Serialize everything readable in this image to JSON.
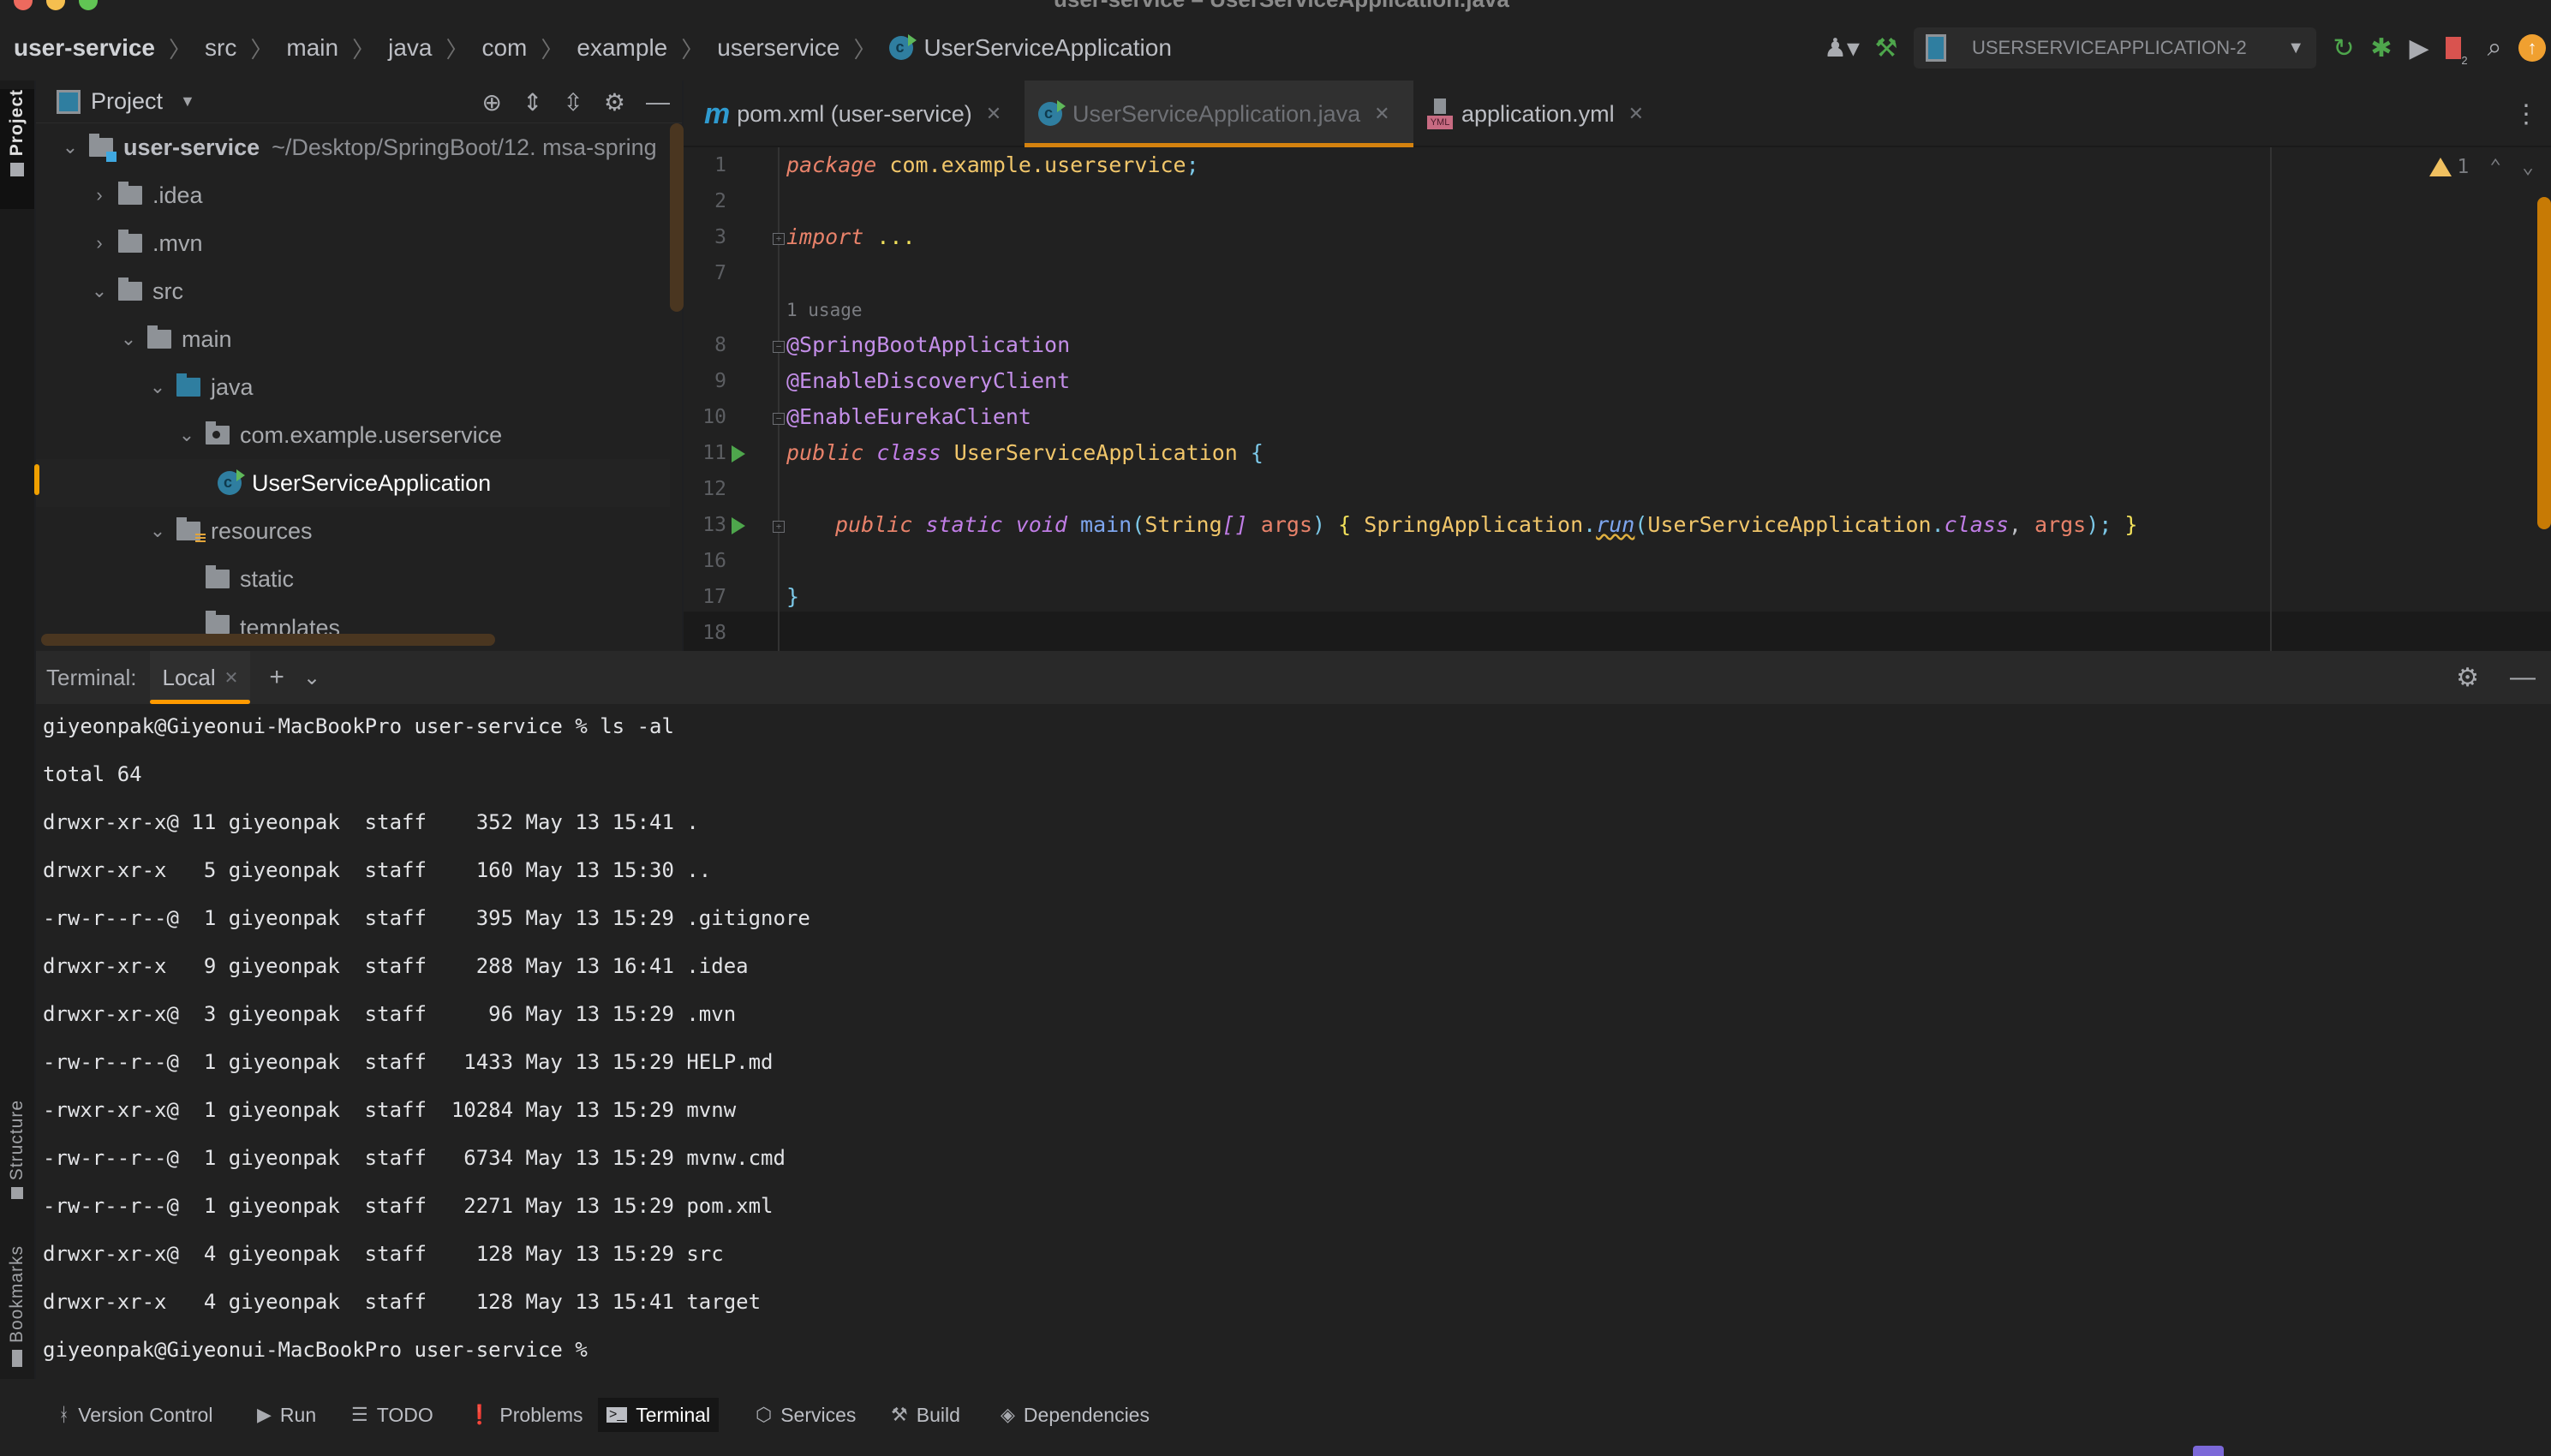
{
  "window": {
    "title": "user-service – UserServiceApplication.java",
    "traffic_colors": [
      "#ed6a5e",
      "#f5bf4f",
      "#61c554"
    ]
  },
  "navbar": {
    "breadcrumb": [
      "user-service",
      "src",
      "main",
      "java",
      "com",
      "example",
      "userservice",
      "UserServiceApplication"
    ],
    "run_config": "USERSERVICEAPPLICATION-2",
    "icons": [
      "vcs-user-icon",
      "build-hammer-icon",
      "run-icon",
      "debug-icon",
      "coverage-icon",
      "stop-icon",
      "search-icon",
      "update-icon"
    ],
    "stop_badge": "2"
  },
  "left_strip": {
    "top": "Project",
    "structure": "Structure",
    "bookmarks": "Bookmarks"
  },
  "project": {
    "title": "Project",
    "tree": [
      {
        "label": "user-service",
        "suffix": "~/Desktop/SpringBoot/12. msa-spring",
        "depth": 0,
        "expanded": true,
        "type": "module"
      },
      {
        "label": ".idea",
        "depth": 1,
        "expanded": false,
        "type": "folder"
      },
      {
        "label": ".mvn",
        "depth": 1,
        "expanded": false,
        "type": "folder"
      },
      {
        "label": "src",
        "depth": 1,
        "expanded": true,
        "type": "folder"
      },
      {
        "label": "main",
        "depth": 2,
        "expanded": true,
        "type": "folder"
      },
      {
        "label": "java",
        "depth": 3,
        "expanded": true,
        "type": "source-folder"
      },
      {
        "label": "com.example.userservice",
        "depth": 4,
        "expanded": true,
        "type": "package"
      },
      {
        "label": "UserServiceApplication",
        "depth": 5,
        "type": "class",
        "selected": true
      },
      {
        "label": "resources",
        "depth": 3,
        "expanded": true,
        "type": "resources-folder"
      },
      {
        "label": "static",
        "depth": 4,
        "type": "folder"
      },
      {
        "label": "templates",
        "depth": 4,
        "type": "folder"
      }
    ]
  },
  "tabs": [
    {
      "label": "pom.xml (user-service)",
      "icon": "maven-icon",
      "active": false
    },
    {
      "label": "UserServiceApplication.java",
      "icon": "class-icon",
      "active": true
    },
    {
      "label": "application.yml",
      "icon": "yaml-icon",
      "active": false
    }
  ],
  "editor": {
    "warnings": "1",
    "usage_hint": "1 usage",
    "line_numbers": [
      "1",
      "2",
      "3",
      "7",
      "8",
      "9",
      "10",
      "11",
      "12",
      "13",
      "16",
      "17",
      "18"
    ],
    "code": {
      "l1_kw": "package",
      "l1_pkg": "com.example.userservice",
      "l1_semi": ";",
      "l3_kw": "import",
      "l3_dots": "...",
      "l8": "@SpringBootApplication",
      "l9": "@EnableDiscoveryClient",
      "l10": "@EnableEurekaClient",
      "l11_public": "public",
      "l11_class": "class",
      "l11_name": "UserServiceApplication",
      "l11_brace": "{",
      "l13_public": "public",
      "l13_static": "static",
      "l13_void": "void",
      "l13_main": "main",
      "l13_paren": "(",
      "l13_string": "String",
      "l13_arr": "[]",
      "l13_args": "args",
      "l13_close": ")",
      "l13_ob": "{",
      "l13_spring": "SpringApplication",
      "l13_dot": ".",
      "l13_run": "run",
      "l13_p2": "(",
      "l13_cls": "UserServiceApplication",
      "l13_dot2": ".",
      "l13_class": "class",
      "l13_comma": ",",
      "l13_args2": "args",
      "l13_end": ");",
      "l13_cb": "}",
      "l17": "}"
    }
  },
  "terminal": {
    "title": "Terminal:",
    "tab": "Local",
    "lines": [
      "giyeonpak@Giyeonui-MacBookPro user-service % ls -al",
      "total 64",
      "drwxr-xr-x@ 11 giyeonpak  staff    352 May 13 15:41 .",
      "drwxr-xr-x   5 giyeonpak  staff    160 May 13 15:30 ..",
      "-rw-r--r--@  1 giyeonpak  staff    395 May 13 15:29 .gitignore",
      "drwxr-xr-x   9 giyeonpak  staff    288 May 13 16:41 .idea",
      "drwxr-xr-x@  3 giyeonpak  staff     96 May 13 15:29 .mvn",
      "-rw-r--r--@  1 giyeonpak  staff   1433 May 13 15:29 HELP.md",
      "-rwxr-xr-x@  1 giyeonpak  staff  10284 May 13 15:29 mvnw",
      "-rw-r--r--@  1 giyeonpak  staff   6734 May 13 15:29 mvnw.cmd",
      "-rw-r--r--@  1 giyeonpak  staff   2271 May 13 15:29 pom.xml",
      "drwxr-xr-x@  4 giyeonpak  staff    128 May 13 15:29 src",
      "drwxr-xr-x   4 giyeonpak  staff    128 May 13 15:41 target",
      "giyeonpak@Giyeonui-MacBookPro user-service %"
    ]
  },
  "bottom_tools": [
    {
      "label": "Version Control",
      "icon": "version-control-icon"
    },
    {
      "label": "Run",
      "icon": "run-icon"
    },
    {
      "label": "TODO",
      "icon": "todo-icon"
    },
    {
      "label": "Problems",
      "icon": "problems-icon"
    },
    {
      "label": "Terminal",
      "icon": "terminal-icon",
      "active": true
    },
    {
      "label": "Services",
      "icon": "services-icon"
    },
    {
      "label": "Build",
      "icon": "build-icon"
    },
    {
      "label": "Dependencies",
      "icon": "dependencies-icon"
    }
  ],
  "colors": {
    "accent": "#d4820f",
    "tab_underline": "#ff9a00",
    "background": "#212121",
    "run_green": "#4ea64c"
  }
}
